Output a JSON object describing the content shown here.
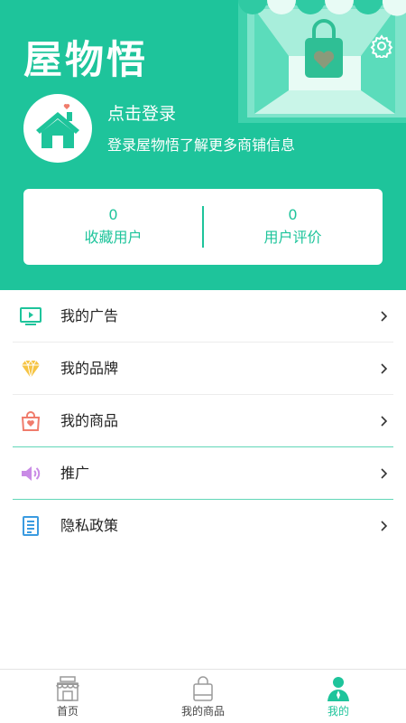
{
  "header": {
    "logo_text": "屋物悟",
    "login_title": "点击登录",
    "login_subtitle": "登录屋物悟了解更多商铺信息"
  },
  "stats": [
    {
      "value": "0",
      "label": "收藏用户"
    },
    {
      "value": "0",
      "label": "用户评价"
    }
  ],
  "menu": [
    {
      "label": "我的广告",
      "icon": "monitor-icon"
    },
    {
      "label": "我的品牌",
      "icon": "diamond-icon"
    },
    {
      "label": "我的商品",
      "icon": "shopping-bag-icon"
    },
    {
      "label": "推广",
      "icon": "speaker-icon"
    },
    {
      "label": "隐私政策",
      "icon": "document-icon"
    }
  ],
  "tabbar": [
    {
      "label": "首页",
      "icon": "store-icon",
      "active": false
    },
    {
      "label": "我的商品",
      "icon": "bag-icon",
      "active": false
    },
    {
      "label": "我的",
      "icon": "user-icon",
      "active": true
    }
  ],
  "colors": {
    "brand": "#1ec49b",
    "text": "#222222",
    "divider": "#ececec",
    "divider_accent": "#62d7b8"
  }
}
